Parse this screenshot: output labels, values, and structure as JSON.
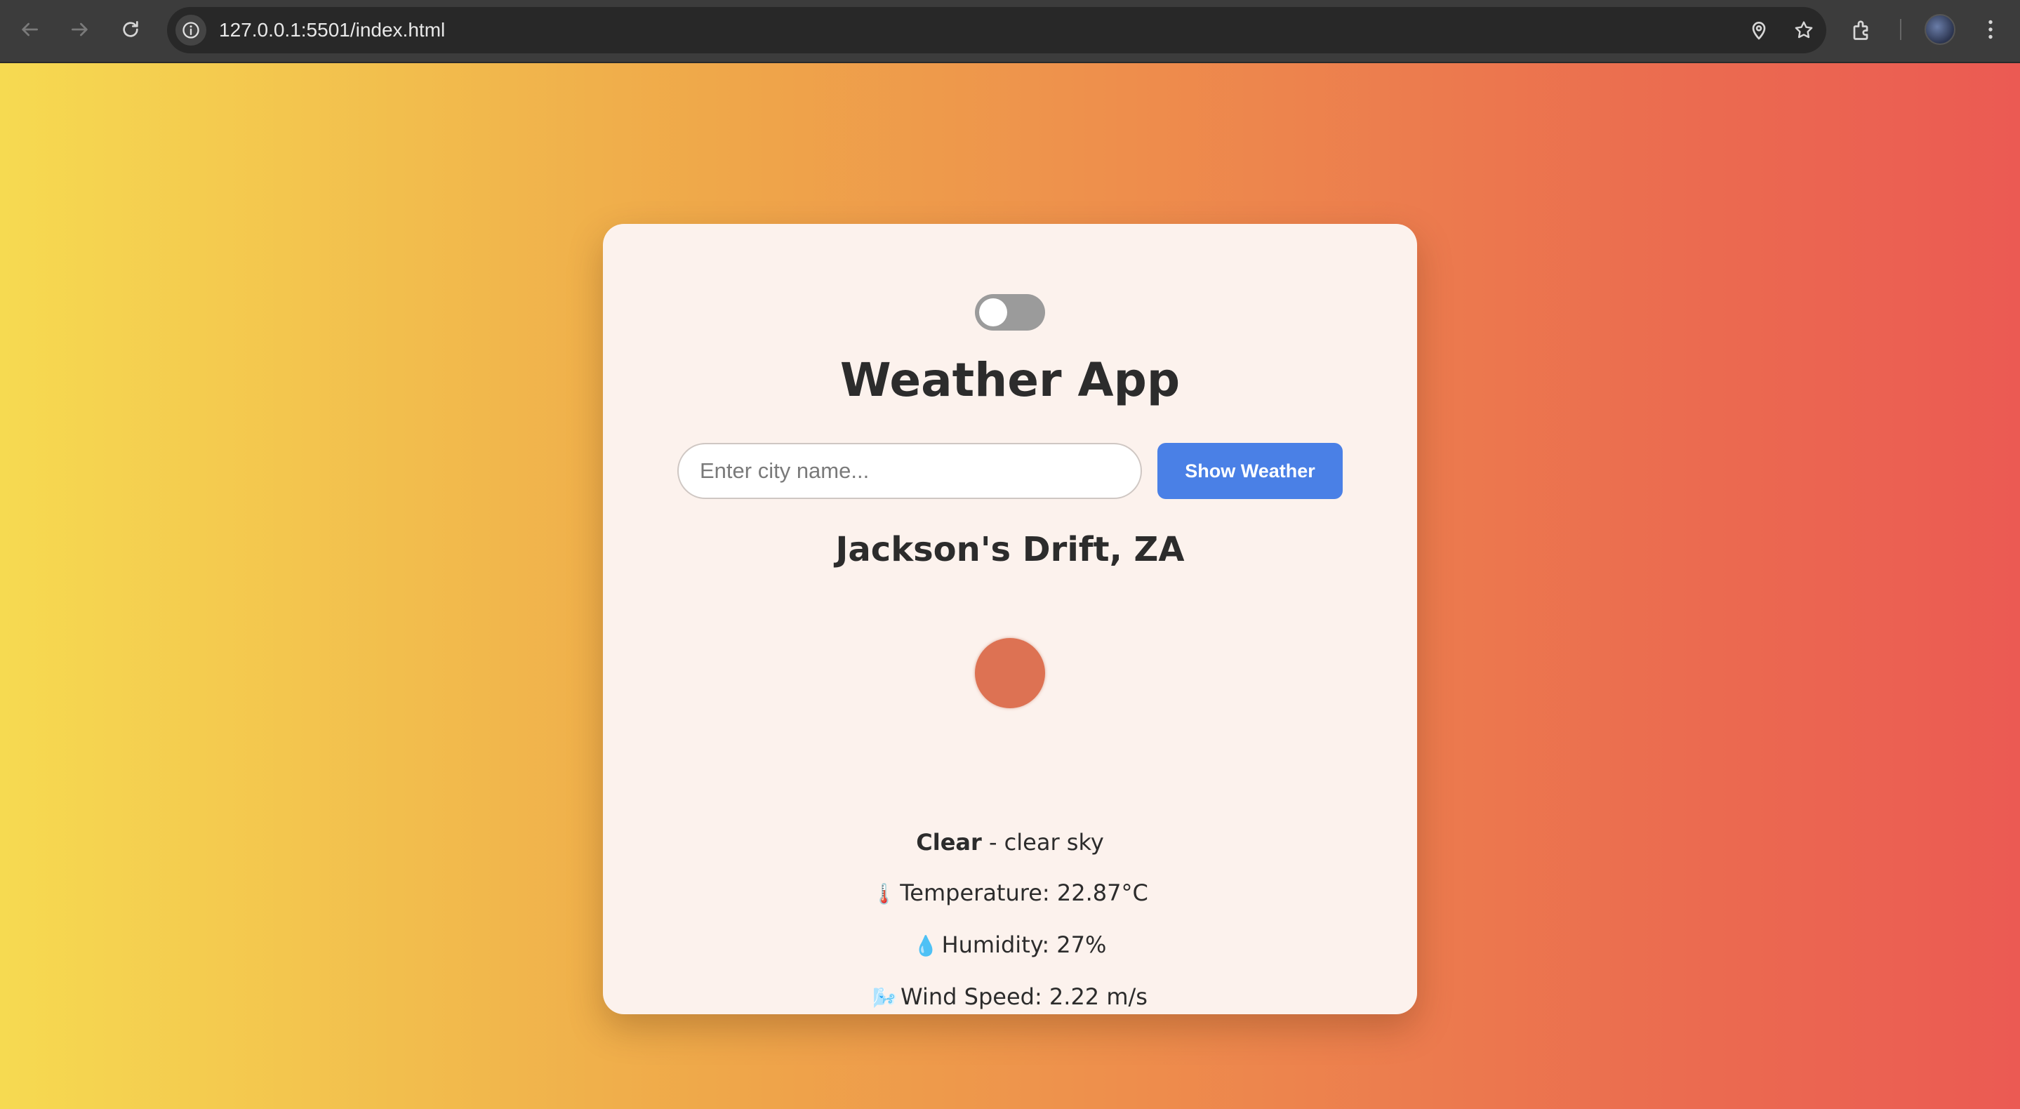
{
  "browser": {
    "url": "127.0.0.1:5501/index.html"
  },
  "app": {
    "title": "Weather App",
    "search_placeholder": "Enter city name...",
    "search_value": "",
    "show_button_label": "Show Weather",
    "dark_mode_toggle_on": false,
    "location": "Jackson's Drift, ZA",
    "weather_main": "Clear",
    "weather_desc_separator": " - ",
    "weather_description": "clear sky",
    "temperature_text": "Temperature: 22.87°C",
    "humidity_text": "Humidity: 27%",
    "wind_text": "Wind Speed: 2.22 m/s",
    "temperature_emoji": "🌡️",
    "humidity_emoji": "💧",
    "wind_emoji": "🌬️",
    "weather_icon_color": "#dd7253"
  },
  "colors": {
    "accent_button": "#4a80e6",
    "card_background": "#fcf2ed"
  }
}
